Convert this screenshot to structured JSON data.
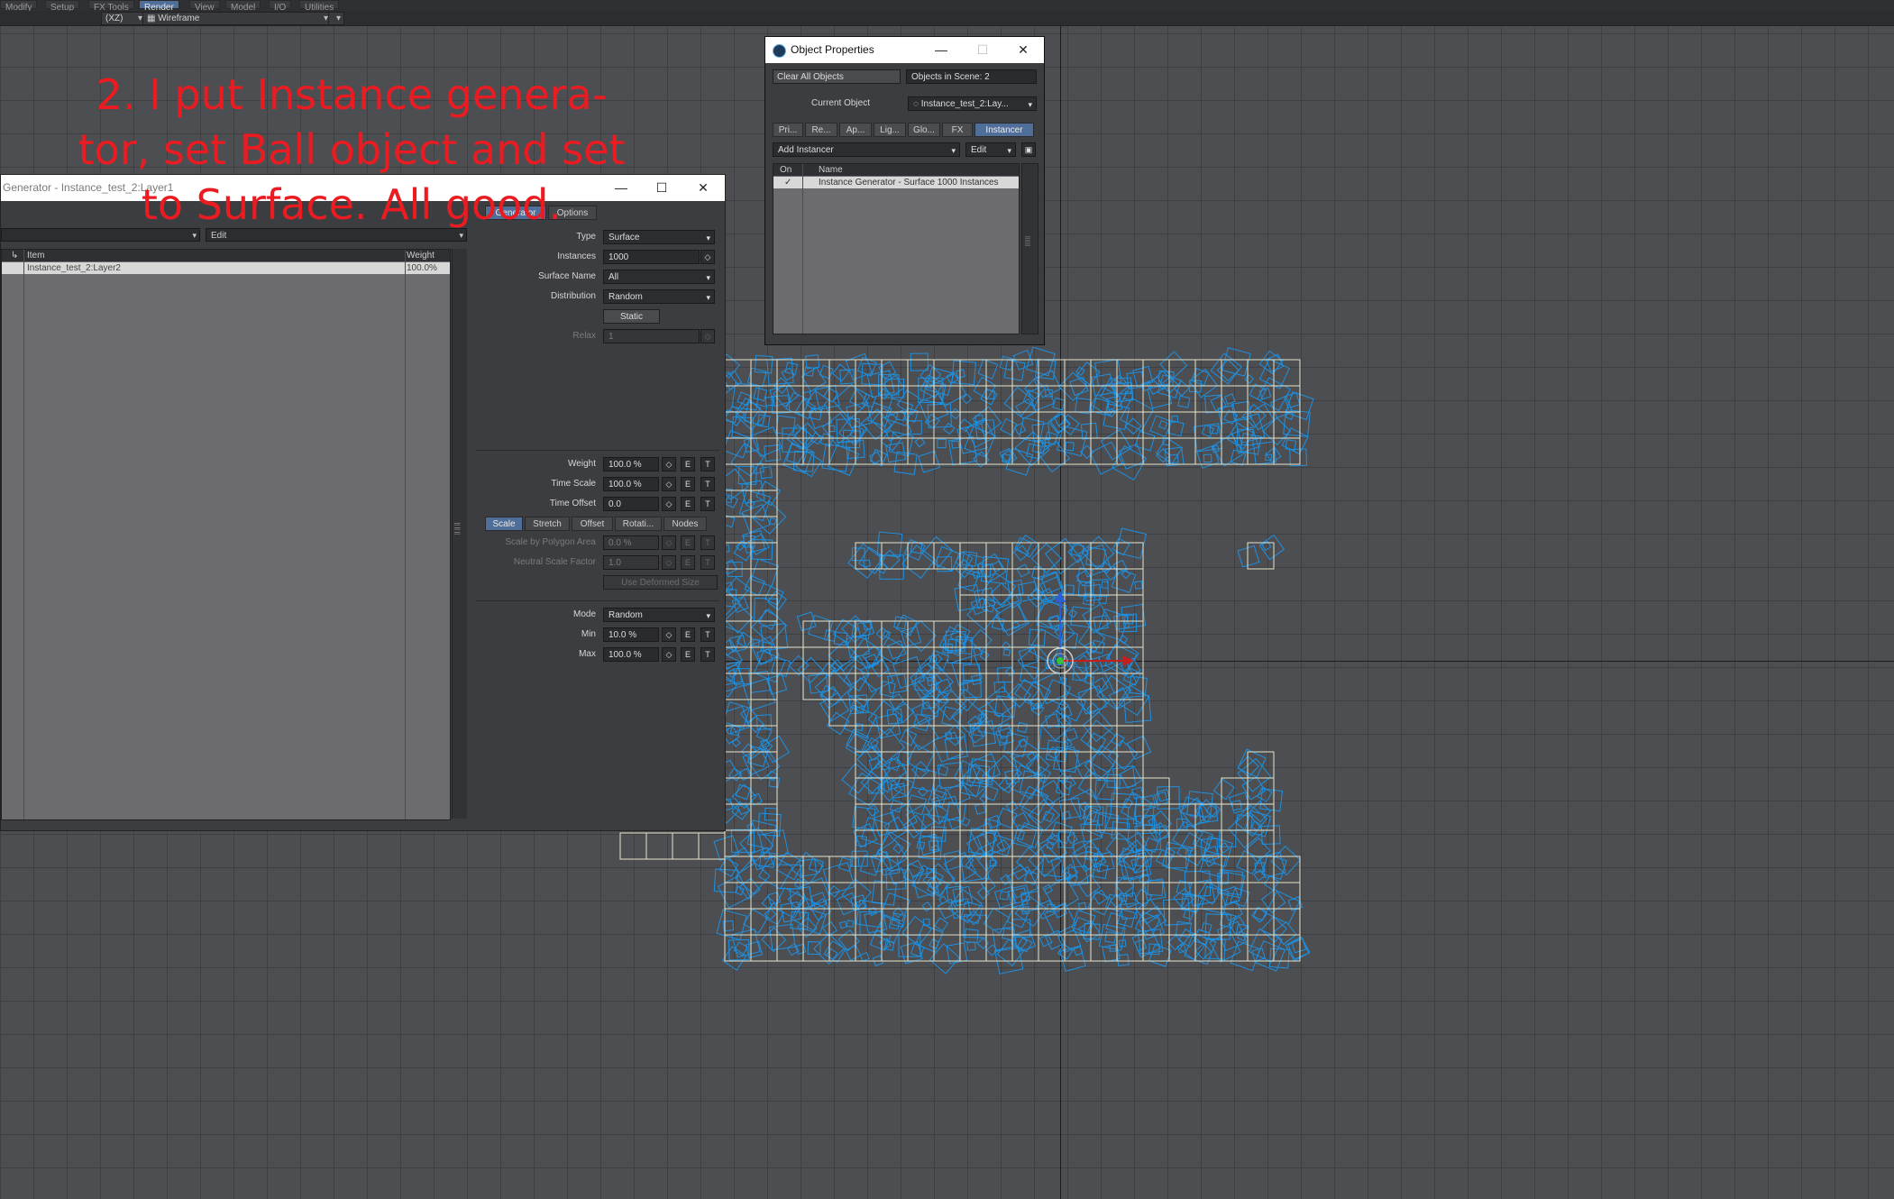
{
  "menubar": {
    "tabs": [
      "Modify",
      "Setup",
      "FX Tools",
      "Render",
      "View",
      "Model",
      "I/O",
      "Utilities"
    ],
    "active_tab": "Render"
  },
  "toolbar": {
    "view_mode": "(XZ)",
    "render_style": "Wireframe"
  },
  "annotation": {
    "text": "2. I put Instance genera-\ntor, set Ball object and set\nto Surface. All good."
  },
  "generator_window": {
    "title": "Generator - Instance_test_2:Layer1",
    "left_dropdown": "",
    "edit_dropdown": "Edit",
    "list": {
      "columns": {
        "item": "Item",
        "weight": "Weight"
      },
      "rows": [
        {
          "item": "Instance_test_2:Layer2",
          "weight": "100.0%"
        }
      ]
    },
    "tabs": {
      "generator": "Generator",
      "options": "Options",
      "active": "Generator"
    },
    "type": {
      "label": "Type",
      "value": "Surface"
    },
    "instances": {
      "label": "Instances",
      "value": "1000"
    },
    "surface_name": {
      "label": "Surface Name",
      "value": "All"
    },
    "distribution": {
      "label": "Distribution",
      "value": "Random"
    },
    "static_button": "Static",
    "relax": {
      "label": "Relax",
      "value": "1"
    },
    "weight": {
      "label": "Weight",
      "value": "100.0 %"
    },
    "time_scale": {
      "label": "Time Scale",
      "value": "100.0 %"
    },
    "time_offset": {
      "label": "Time Offset",
      "value": "0.0"
    },
    "subtabs": [
      "Scale",
      "Stretch",
      "Offset",
      "Rotati...",
      "Nodes"
    ],
    "active_subtab": "Scale",
    "scale_by_polygon_area": {
      "label": "Scale by Polygon Area",
      "value": "0.0 %"
    },
    "neutral_scale_factor": {
      "label": "Neutral Scale Factor",
      "value": "1.0"
    },
    "use_deformed_size": "Use Deformed Size",
    "mode": {
      "label": "Mode",
      "value": "Random"
    },
    "min": {
      "label": "Min",
      "value": "10.0 %"
    },
    "max": {
      "label": "Max",
      "value": "100.0 %"
    },
    "btn_e": "E",
    "btn_t": "T"
  },
  "object_window": {
    "title": "Object Properties",
    "clear_all": "Clear All Objects",
    "objects_in_scene": "Objects in Scene: 2",
    "current_object_label": "Current Object",
    "current_object_value": "Instance_test_2:Lay...",
    "tabs": [
      "Pri...",
      "Re...",
      "Ap...",
      "Lig...",
      "Glo...",
      "FX",
      "Instancer"
    ],
    "active_tab": "Instancer",
    "add_instancer": "Add Instancer",
    "edit_dropdown": "Edit",
    "list": {
      "columns": {
        "on": "On",
        "name": "Name"
      },
      "rows": [
        {
          "on": "✓",
          "name": "Instance Generator - Surface 1000 Instances"
        }
      ]
    }
  },
  "colors": {
    "accent": "#4f6e99",
    "annotation": "#ea1c22",
    "instances": "#1e90e0",
    "mesh": "#e8e4c8",
    "grid": "#3f4044"
  }
}
